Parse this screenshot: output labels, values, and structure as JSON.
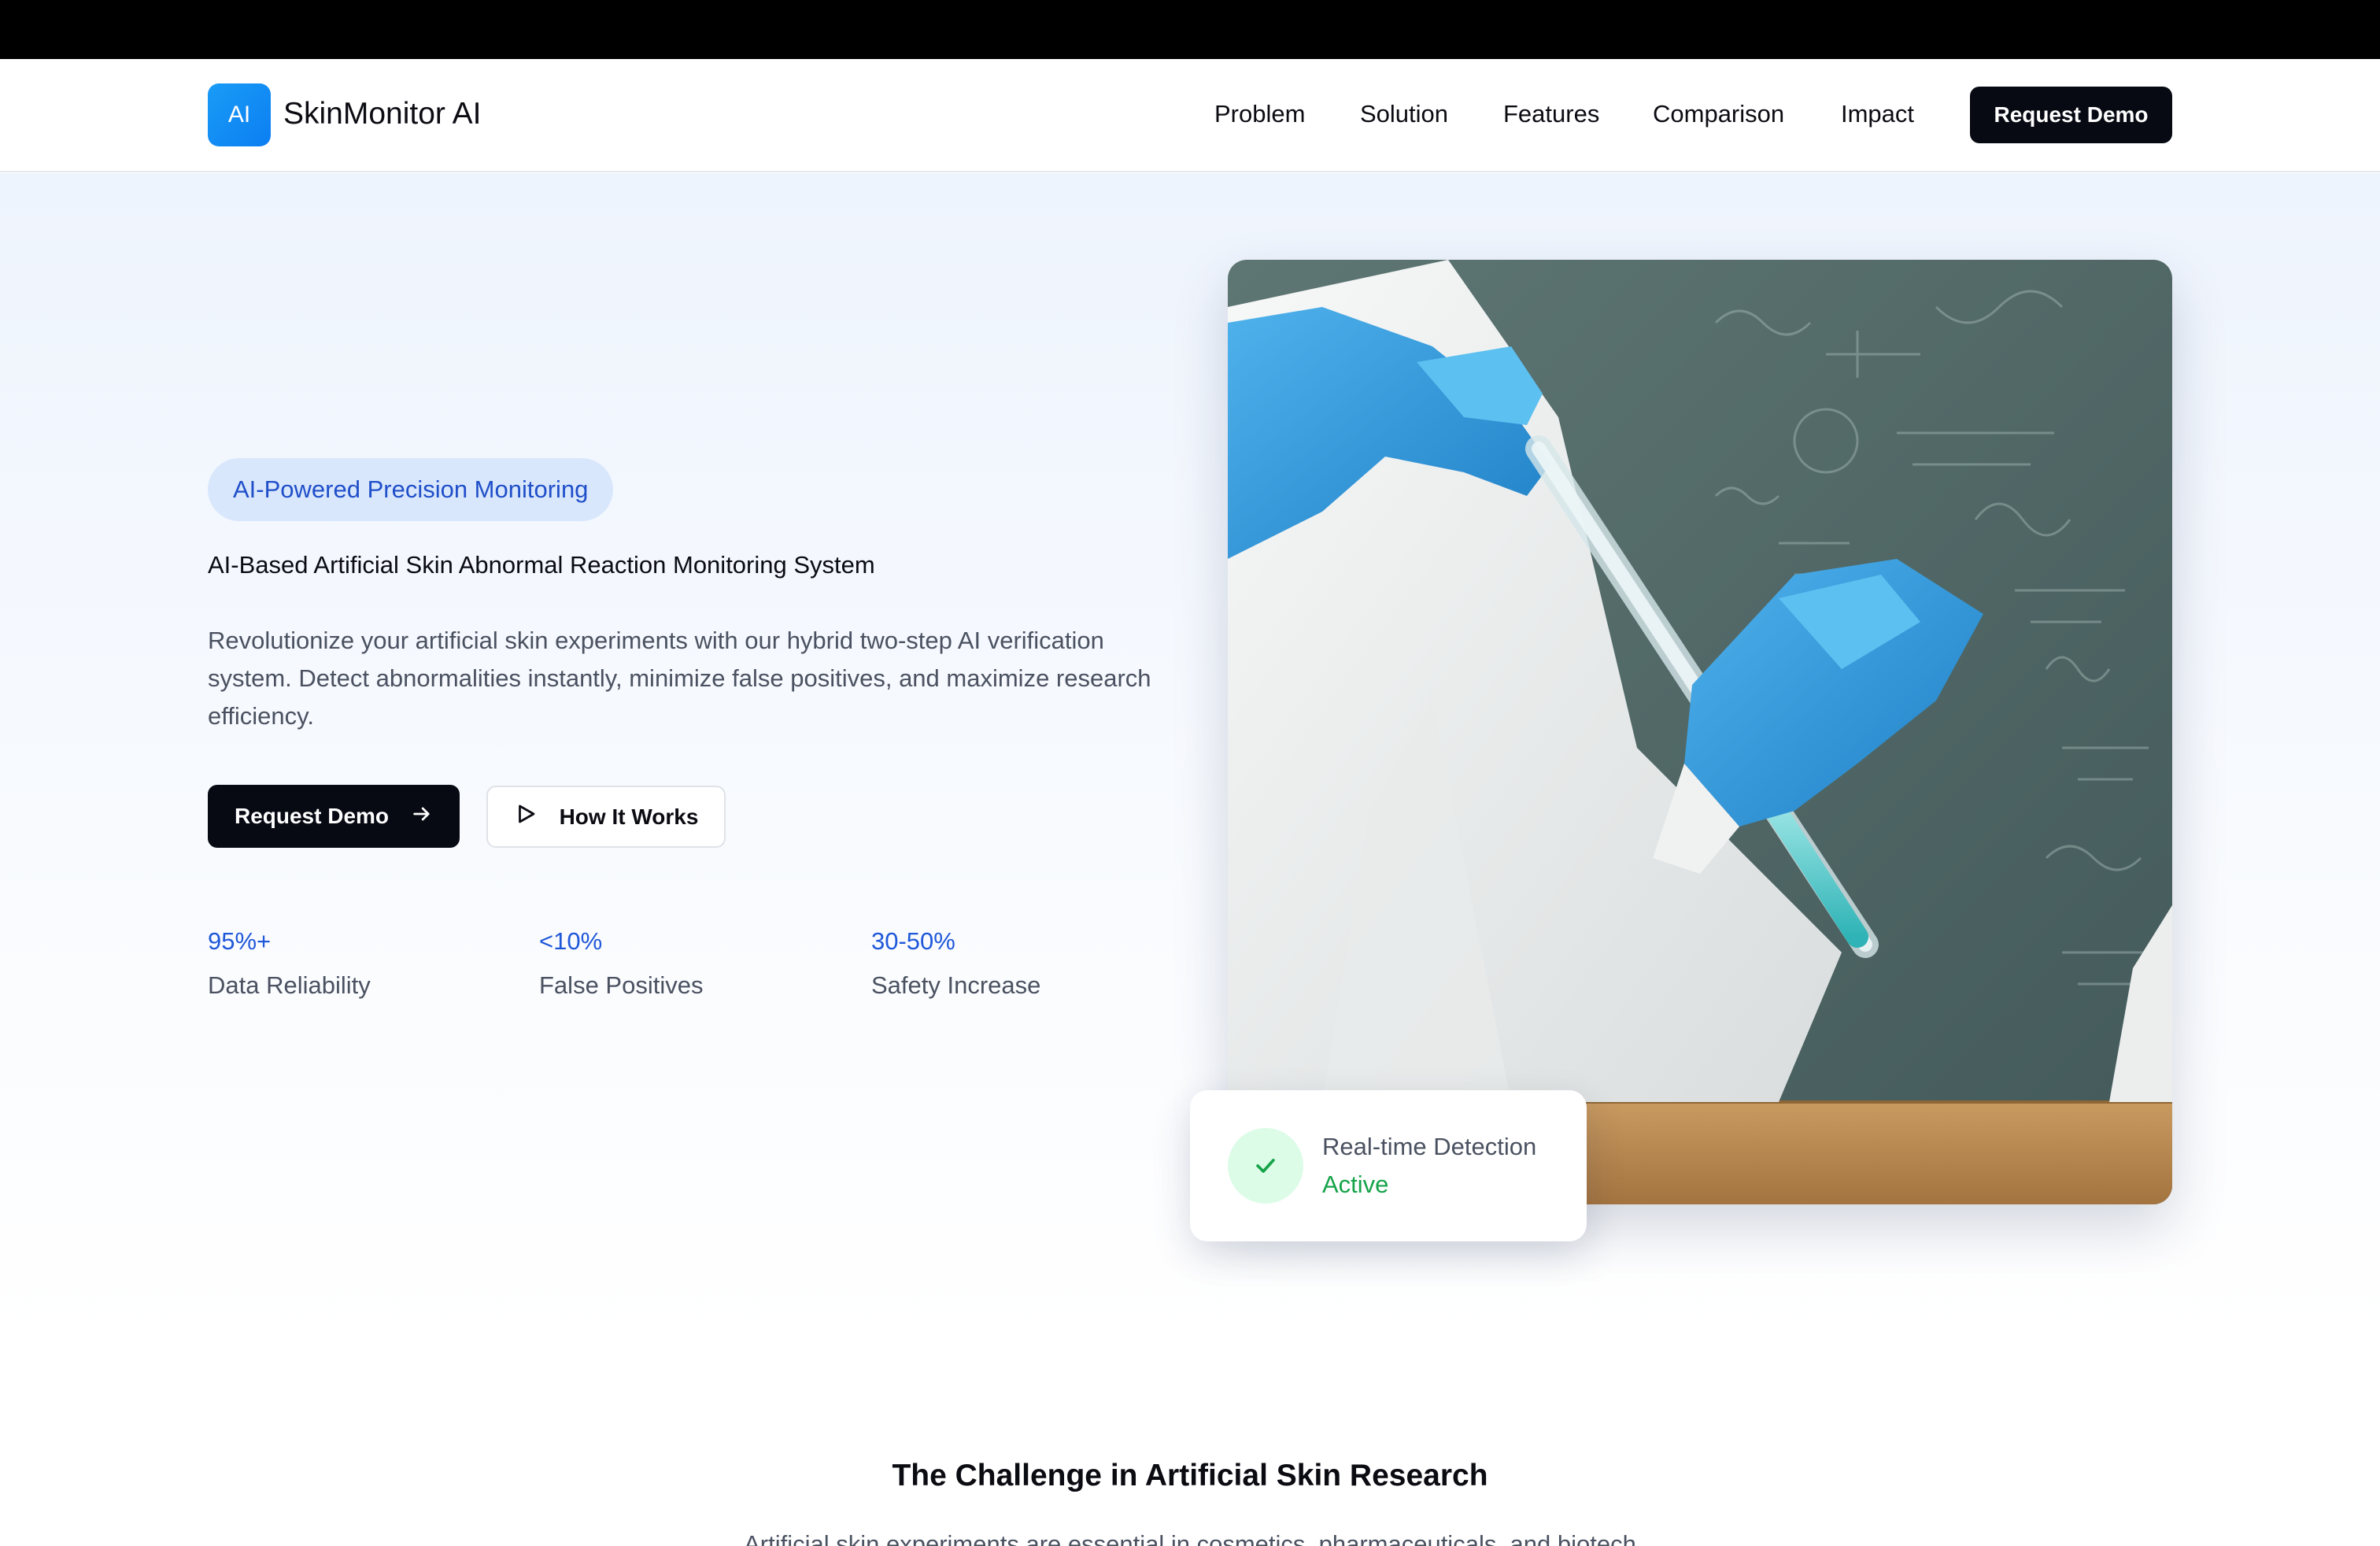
{
  "nav": {
    "logo_badge": "AI",
    "brand": "SkinMonitor AI",
    "links": [
      "Problem",
      "Solution",
      "Features",
      "Comparison",
      "Impact"
    ],
    "cta": "Request Demo"
  },
  "hero": {
    "badge": "AI-Powered Precision Monitoring",
    "subtitle": "AI-Based Artificial Skin Abnormal Reaction Monitoring System",
    "description": "Revolutionize your artificial skin experiments with our hybrid two-step AI verification system. Detect abnormalities instantly, minimize false positives, and maximize research efficiency.",
    "primary_button": "Request Demo",
    "primary_button_icon": "arrow-right-icon",
    "secondary_button": "How It Works",
    "secondary_button_icon": "play-icon",
    "stats": [
      {
        "value": "95%+",
        "label": "Data Reliability"
      },
      {
        "value": "<10%",
        "label": "False Positives"
      },
      {
        "value": "30-50%",
        "label": "Safety Increase"
      }
    ],
    "image": {
      "description_icon": "lab-scientist-test-tube-photo"
    },
    "detection": {
      "title": "Real-time Detection",
      "status": "Active",
      "status_color": "#16a34a",
      "icon": "check-icon"
    }
  },
  "challenge": {
    "title": "The Challenge in Artificial Skin Research",
    "text": "Artificial skin experiments are essential in cosmetics, pharmaceuticals, and biotech"
  },
  "colors": {
    "accent": "#1f58d9",
    "dark_button": "#070913",
    "logo": "#0b7ef2"
  }
}
